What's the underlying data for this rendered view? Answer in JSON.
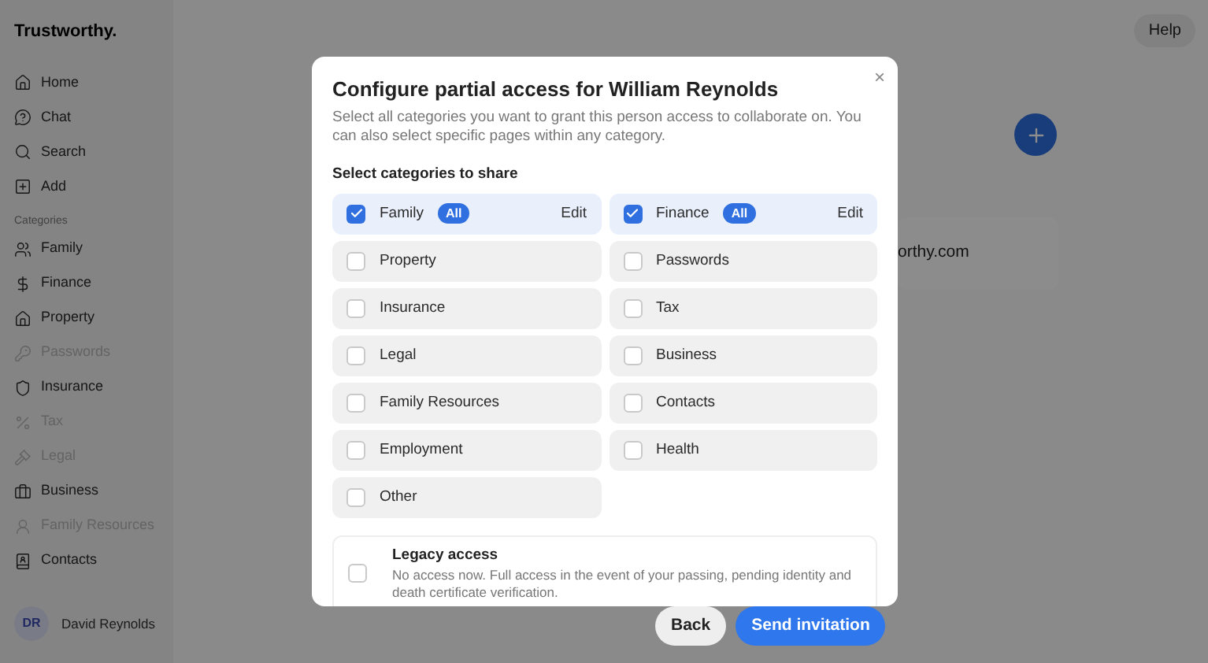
{
  "brand": "Trustworthy.",
  "nav": [
    {
      "label": "Home",
      "disabled": false
    },
    {
      "label": "Chat",
      "disabled": false
    },
    {
      "label": "Search",
      "disabled": false
    },
    {
      "label": "Add",
      "disabled": false
    }
  ],
  "categories_heading": "Categories",
  "categories_nav": [
    {
      "label": "Family",
      "disabled": false
    },
    {
      "label": "Finance",
      "disabled": false
    },
    {
      "label": "Property",
      "disabled": false
    },
    {
      "label": "Passwords",
      "disabled": true
    },
    {
      "label": "Insurance",
      "disabled": false
    },
    {
      "label": "Tax",
      "disabled": true
    },
    {
      "label": "Legal",
      "disabled": true
    },
    {
      "label": "Business",
      "disabled": false
    },
    {
      "label": "Family Resources",
      "disabled": true
    },
    {
      "label": "Contacts",
      "disabled": false
    }
  ],
  "user": {
    "initials": "DR",
    "name": "David Reynolds"
  },
  "help_button": "Help",
  "card_text": "orthy.com",
  "dialog": {
    "title": "Configure partial access for William Reynolds",
    "close": "×",
    "description": "Select all categories you want to grant this person access to collaborate on. You can also select specific pages within any category.",
    "section_label": "Select categories to share",
    "options": [
      {
        "label": "Family",
        "checked": true,
        "badge": "All",
        "action": "Edit"
      },
      {
        "label": "Finance",
        "checked": true,
        "badge": "All",
        "action": "Edit"
      },
      {
        "label": "Property",
        "checked": false
      },
      {
        "label": "Passwords",
        "checked": false
      },
      {
        "label": "Insurance",
        "checked": false
      },
      {
        "label": "Tax",
        "checked": false
      },
      {
        "label": "Legal",
        "checked": false
      },
      {
        "label": "Business",
        "checked": false
      },
      {
        "label": "Family Resources",
        "checked": false
      },
      {
        "label": "Contacts",
        "checked": false
      },
      {
        "label": "Employment",
        "checked": false
      },
      {
        "label": "Health",
        "checked": false
      },
      {
        "label": "Other",
        "checked": false
      }
    ],
    "legacy": {
      "title": "Legacy access",
      "description": "No access now. Full access in the event of your passing, pending identity and death certificate verification.",
      "checked": false
    }
  },
  "buttons": [
    {
      "label": "Back",
      "kind": "secondary"
    },
    {
      "label": "Send invitation",
      "kind": "primary"
    }
  ]
}
